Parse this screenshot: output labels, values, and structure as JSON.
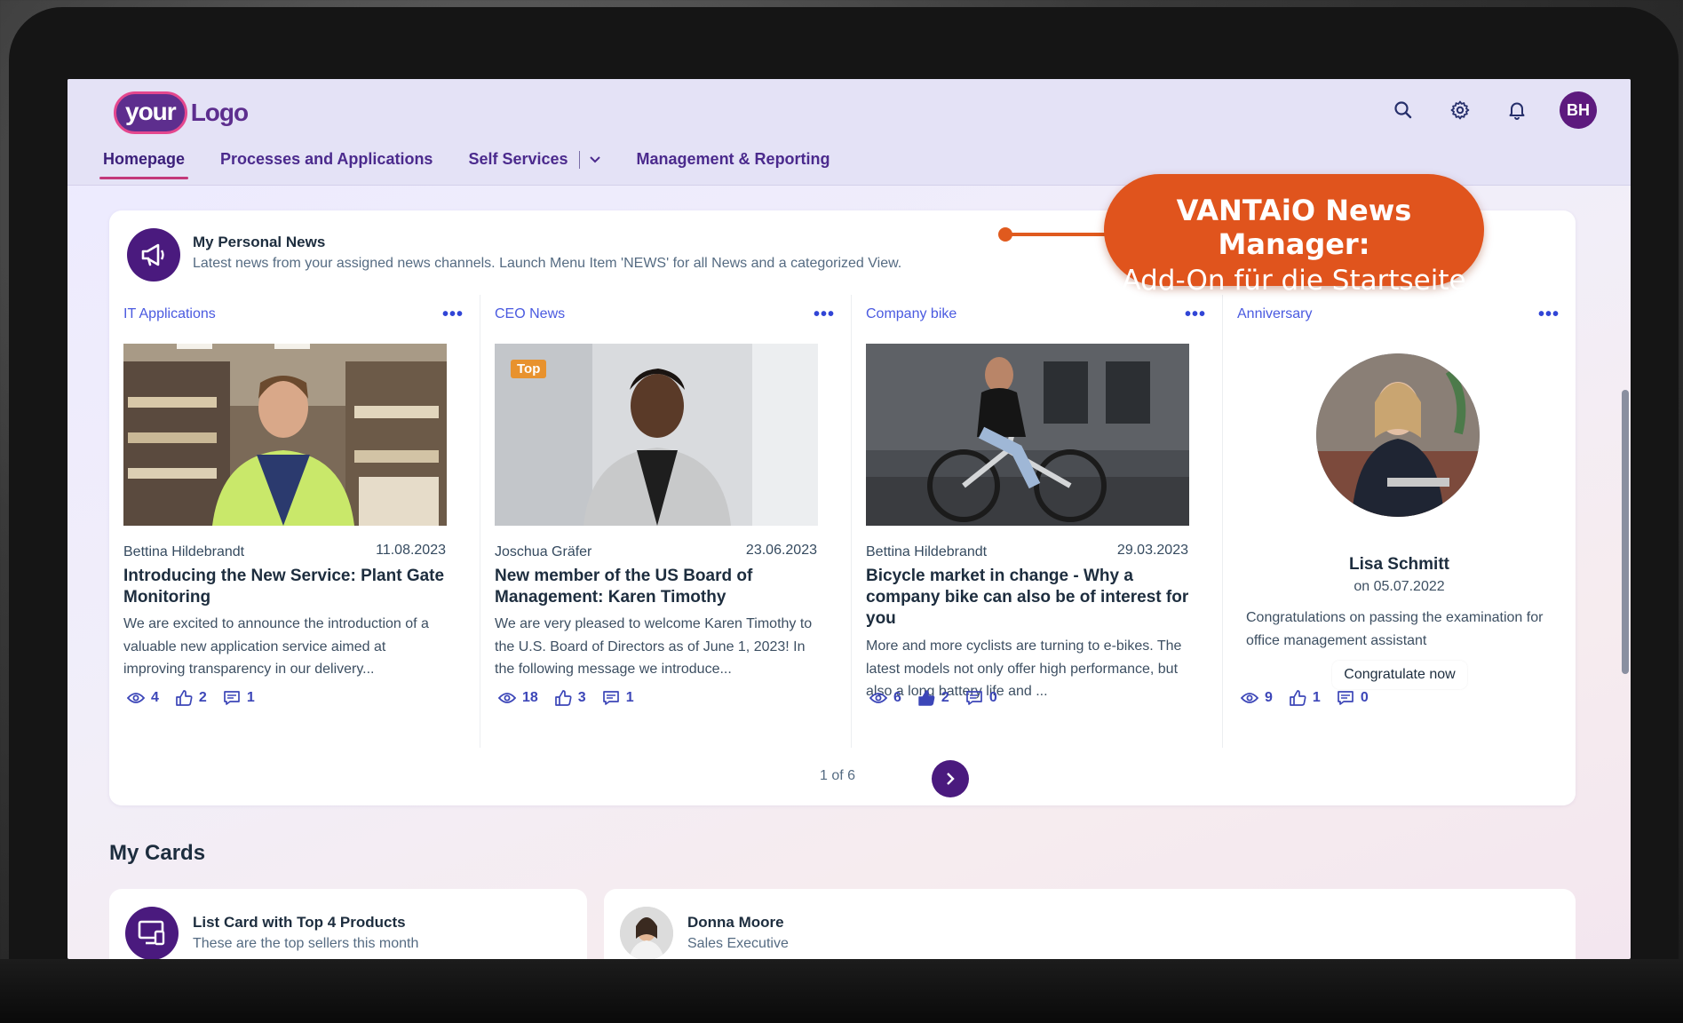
{
  "header": {
    "logo_part1": "your",
    "logo_part2": "Logo",
    "avatar_initials": "BH"
  },
  "nav": {
    "items": [
      {
        "label": "Homepage"
      },
      {
        "label": "Processes and Applications"
      },
      {
        "label": "Self Services"
      },
      {
        "label": "Management & Reporting"
      }
    ]
  },
  "news": {
    "title": "My Personal News",
    "subtitle": "Latest news from your assigned news channels. Launch Menu Item 'NEWS' for all News and a categorized View.",
    "cards": [
      {
        "category": "IT Applications",
        "author": "Bettina Hildebrandt",
        "date": "11.08.2023",
        "title": "Introducing the New Service: Plant Gate Monitoring",
        "text": "We are excited to announce the introduction of a valuable new application service aimed at improving transparency in our delivery...",
        "views": "4",
        "likes": "2",
        "comments": "1"
      },
      {
        "category": "CEO News",
        "badge": "Top",
        "author": "Joschua Gräfer",
        "date": "23.06.2023",
        "title": "New member of the US Board of Management: Karen Timothy",
        "text": "We are very pleased to welcome Karen Timothy to the U.S. Board of Directors as of June 1, 2023! In the following message we introduce...",
        "views": "18",
        "likes": "3",
        "comments": "1"
      },
      {
        "category": "Company bike",
        "author": "Bettina Hildebrandt",
        "date": "29.03.2023",
        "title": "Bicycle market in change - Why a company bike can also be of interest for you",
        "text": "More and more cyclists are turning to e-bikes. The latest models not only offer high performance, but also a long battery life and ...",
        "views": "6",
        "likes": "2",
        "comments": "0"
      },
      {
        "category": "Anniversary",
        "name": "Lisa Schmitt",
        "date": "on 05.07.2022",
        "text": "Congratulations on passing the examination for office management assistant",
        "button": "Congratulate now",
        "views": "9",
        "likes": "1",
        "comments": "0"
      }
    ],
    "pager": "1 of 6"
  },
  "callout": {
    "line1": "VANTAiO News Manager:",
    "line2": "Add-On für die Startseite",
    "color": "#e0541d"
  },
  "mycards": {
    "title": "My Cards",
    "cards": [
      {
        "title": "List Card with Top 4 Products",
        "subtitle": "These are the top sellers this month"
      },
      {
        "title": "Donna Moore",
        "subtitle": "Sales Executive"
      }
    ]
  },
  "colors": {
    "accent": "#4a1a7e",
    "link": "#4a5ae0",
    "nav_underline": "#c3387a"
  }
}
